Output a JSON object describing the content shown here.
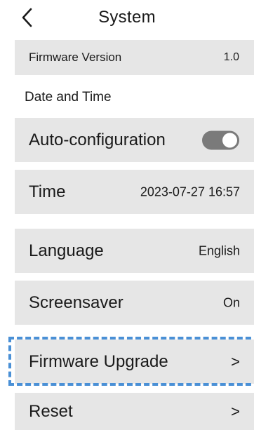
{
  "header": {
    "title": "System",
    "back_icon": "chevron-left-icon"
  },
  "firmware_version": {
    "label": "Firmware Version",
    "value": "1.0"
  },
  "date_time_section": {
    "label": "Date and Time"
  },
  "auto_configuration": {
    "label": "Auto-configuration",
    "enabled": true
  },
  "time": {
    "label": "Time",
    "value": "2023-07-27 16:57"
  },
  "language": {
    "label": "Language",
    "value": "English"
  },
  "screensaver": {
    "label": "Screensaver",
    "value": "On"
  },
  "firmware_upgrade": {
    "label": "Firmware Upgrade",
    "chevron": ">"
  },
  "reset": {
    "label": "Reset",
    "chevron": ">"
  },
  "colors": {
    "row_background": "#e6e6e6",
    "toggle_on": "#7a7a7a",
    "highlight_border": "#4a90d6"
  }
}
